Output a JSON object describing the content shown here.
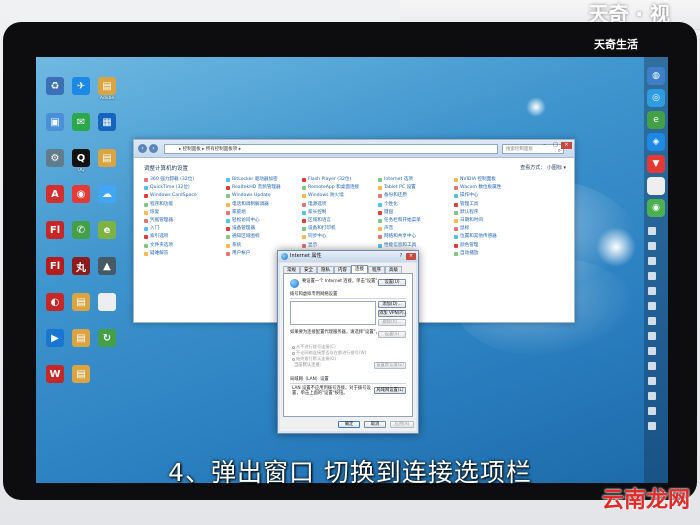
{
  "watermark_top": "天奇生活",
  "watermark_top_large": "天奇 · 视",
  "caption": "4、弹出窗口 切换到连接选项栏",
  "watermark_bottom": "云南龙网",
  "desktop_icons": [
    {
      "label": "",
      "color": "#3b6fb6",
      "glyph": "♻"
    },
    {
      "label": "",
      "color": "#1e88e5",
      "glyph": "✈"
    },
    {
      "label": "Adobe",
      "color": "#d9a441",
      "glyph": "▤"
    },
    {
      "label": "",
      "color": "#4a90d9",
      "glyph": "▣"
    },
    {
      "label": "",
      "color": "#2aa84a",
      "glyph": "✉"
    },
    {
      "label": "",
      "color": "#1565c0",
      "glyph": "▦"
    },
    {
      "label": "",
      "color": "#607d8b",
      "glyph": "⚙"
    },
    {
      "label": "QQ",
      "color": "#111111",
      "glyph": "Q"
    },
    {
      "label": "",
      "color": "#d9a441",
      "glyph": "▤"
    },
    {
      "label": "",
      "color": "#d32f2f",
      "glyph": "A"
    },
    {
      "label": "",
      "color": "#e53935",
      "glyph": "◉"
    },
    {
      "label": "",
      "color": "#42a5f5",
      "glyph": "☁"
    },
    {
      "label": "",
      "color": "#c62828",
      "glyph": "Fl"
    },
    {
      "label": "",
      "color": "#43a047",
      "glyph": "✆"
    },
    {
      "label": "",
      "color": "#7cb342",
      "glyph": "e"
    },
    {
      "label": "",
      "color": "#b71c1c",
      "glyph": "Fl"
    },
    {
      "label": "",
      "color": "#8e1b1b",
      "glyph": "丸"
    },
    {
      "label": "",
      "color": "#455a64",
      "glyph": "▲"
    },
    {
      "label": "",
      "color": "#c62828",
      "glyph": "◐"
    },
    {
      "label": "",
      "color": "#d9a441",
      "glyph": "▤"
    },
    {
      "label": "",
      "color": "#eceff1",
      "glyph": ""
    },
    {
      "label": "",
      "color": "#1976d2",
      "glyph": "▶"
    },
    {
      "label": "",
      "color": "#d9a441",
      "glyph": "▤"
    },
    {
      "label": "",
      "color": "#43a047",
      "glyph": "↻"
    },
    {
      "label": "",
      "color": "#c62828",
      "glyph": "W"
    },
    {
      "label": "",
      "color": "#d9a441",
      "glyph": "▤"
    }
  ],
  "sidebar_icons": [
    {
      "color": "#3f7fc9",
      "glyph": "◍"
    },
    {
      "color": "#2f9be0",
      "glyph": "◎"
    },
    {
      "color": "#43a047",
      "glyph": "e"
    },
    {
      "color": "#1e88e5",
      "glyph": "◈"
    },
    {
      "color": "#e53935",
      "glyph": "▼"
    },
    {
      "color": "#eeeeee",
      "glyph": ""
    },
    {
      "color": "#4caf50",
      "glyph": "◉"
    }
  ],
  "control_panel": {
    "address": "▸ 控制面板 ▸ 所有控制面板项 ▸",
    "search_placeholder": "搜索控制面板",
    "title": "调整计算机的设置",
    "view_by": "查看方式：  小图标 ▾",
    "items": [
      [
        "360 强力卸载 (32位)",
        "BitLocker 驱动器加密",
        "Flash Player (32位)",
        "Internet 选项",
        "NVIDIA 控制面板"
      ],
      [
        "QuickTime (32位)",
        "RealtekHD 音频管理器",
        "RemoteApp 和桌面连接",
        "Tablet PC 设置",
        "Wacom 数位板属性"
      ],
      [
        "Windows CardSpace",
        "Windows Update",
        "Windows 防火墙",
        "备份和还原",
        "操作中心"
      ],
      [
        "程序和功能",
        "电话和调制解调器",
        "电源选项",
        "个性化",
        "管理工具"
      ],
      [
        "恢复",
        "家庭组",
        "家长控制",
        "键盘",
        "默认程序"
      ],
      [
        "凭据管理器",
        "轻松访问中心",
        "区域和语言",
        "任务栏和开始菜单",
        "日期和时间"
      ],
      [
        "入门",
        "设备管理器",
        "设备和打印机",
        "声音",
        "鼠标"
      ],
      [
        "索引选项",
        "通知区域图标",
        "同步中心",
        "网络和共享中心",
        "位置和其他传感器"
      ],
      [
        "文件夹选项",
        "系统",
        "显示",
        "性能信息和工具",
        "颜色管理"
      ],
      [
        "疑难解答",
        "用户帐户",
        "语音识别",
        "桌面小工具",
        "自动播放"
      ]
    ]
  },
  "dialog": {
    "title": "Internet 属性",
    "help": "?",
    "close": "×",
    "tabs": [
      "常规",
      "安全",
      "隐私",
      "内容",
      "连接",
      "程序",
      "高级"
    ],
    "active_tab": "连接",
    "setup_text": "要设置一个 Internet 连接，单击\"设置\"。",
    "setup_button": "设置(U)",
    "dialup_title": "拨号和虚拟专用网络设置",
    "add_button": "添加(D)...",
    "add_vpn_button": "添加 VPN(P)...",
    "remove_button": "删除(R)...",
    "proxy_text": "如果要为连接配置代理服务器，请选择\"设置\"。",
    "settings_button": "设置(S)",
    "radio_1": "从不进行拨号连接(C)",
    "radio_2": "不论网络连接是否存在都进行拨号(W)",
    "radio_3": "始终拨打默认连接(O)",
    "current_label": "当前默认连接：",
    "set_default_button": "设置默认值(E)",
    "lan_title": "局域网（LAN）设置",
    "lan_text": "LAN 设置不应用到拨号连接。对于拨号设置，单击上面的\"设置\"按钮。",
    "lan_button": "局域网设置(L)",
    "ok": "确定",
    "cancel": "取消",
    "apply": "应用(A)"
  }
}
